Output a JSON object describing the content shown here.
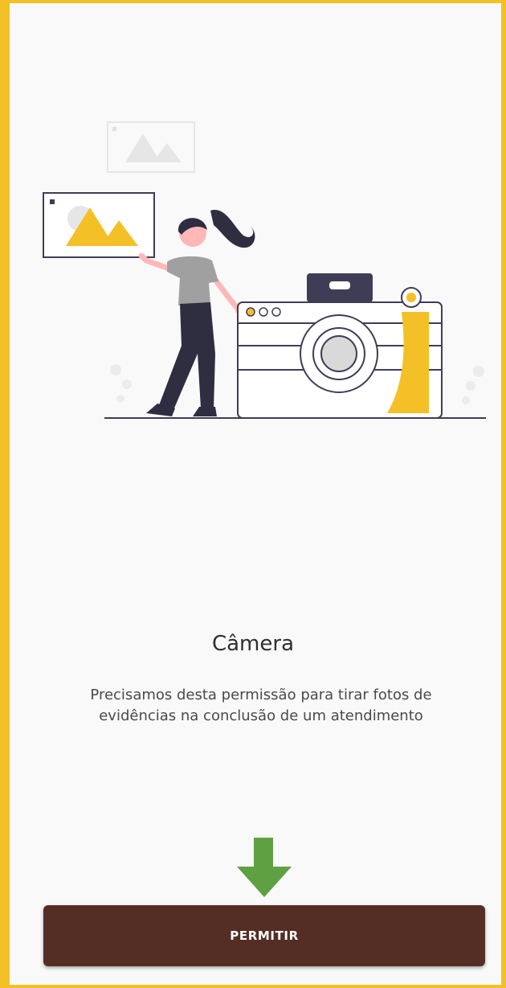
{
  "screen": {
    "title": "Câmera",
    "description": "Precisamos desta permissão para tirar fotos de evidências na conclusão de um atendimento"
  },
  "illustration": {
    "icon": "woman-with-camera-illustration",
    "accent_color": "#f4c027",
    "dark_color": "#3f3d56"
  },
  "hint": {
    "icon": "arrow-down-icon",
    "color": "#5fa142"
  },
  "button": {
    "label": "PERMITIR",
    "color": "#542e25"
  },
  "colors": {
    "border": "#f4c027"
  }
}
